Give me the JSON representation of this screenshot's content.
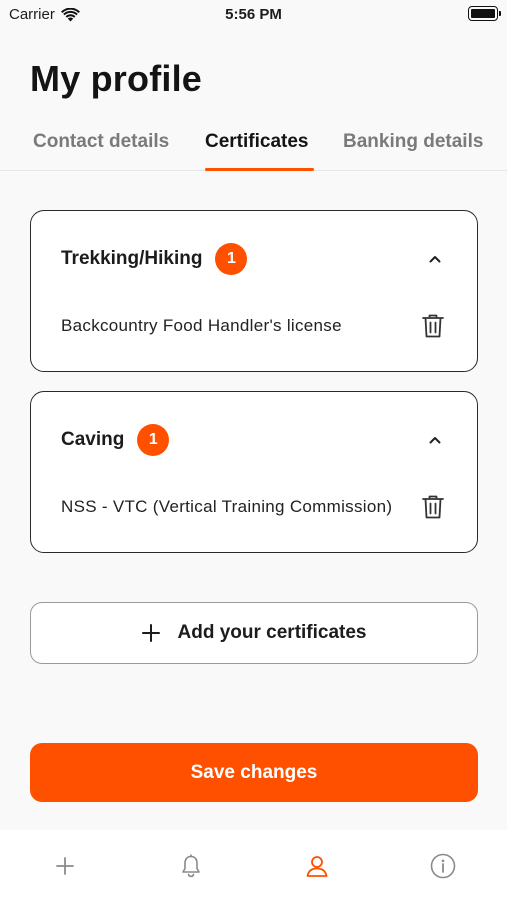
{
  "status_bar": {
    "carrier": "Carrier",
    "time": "5:56 PM"
  },
  "page": {
    "title": "My profile"
  },
  "tabs": [
    {
      "label": "Contact details",
      "active": false
    },
    {
      "label": "Certificates",
      "active": true
    },
    {
      "label": "Banking details",
      "active": false
    }
  ],
  "cards": [
    {
      "title": "Trekking/Hiking",
      "count": "1",
      "certificates": [
        "Backcountry Food Handler's license"
      ]
    },
    {
      "title": "Caving",
      "count": "1",
      "certificates": [
        "NSS - VTC (Vertical Training Commission)"
      ]
    }
  ],
  "actions": {
    "add_label": "Add your certificates",
    "save_label": "Save changes"
  },
  "bottom_nav": [
    {
      "icon": "plus-icon",
      "active": false
    },
    {
      "icon": "bell-icon",
      "active": false
    },
    {
      "icon": "user-icon",
      "active": true
    },
    {
      "icon": "info-icon",
      "active": false
    }
  ],
  "colors": {
    "accent": "#ff5000",
    "text": "#1c1c1c",
    "inactive_tab": "#7a7a7a",
    "background": "#f9f9f9"
  }
}
